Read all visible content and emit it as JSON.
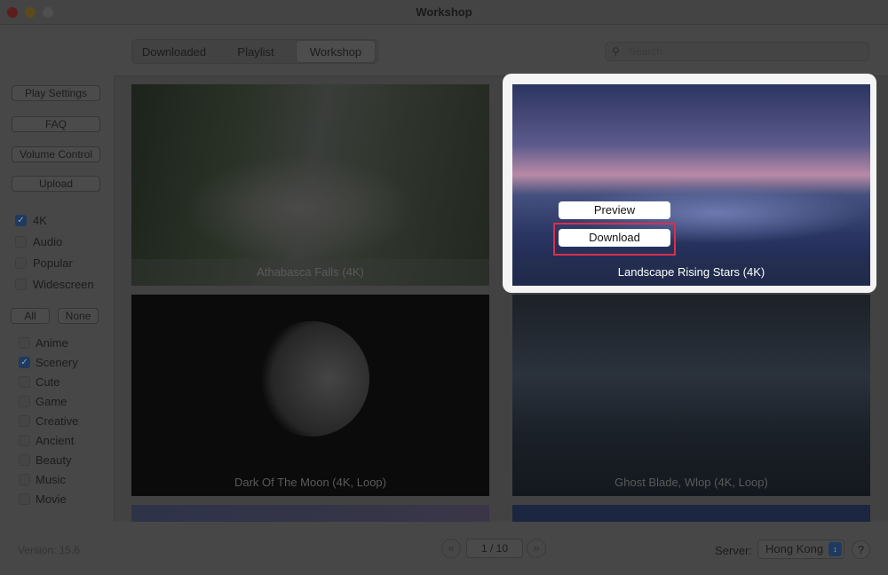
{
  "window": {
    "title": "Workshop"
  },
  "tabs": [
    {
      "label": "Downloaded"
    },
    {
      "label": "Playlist"
    },
    {
      "label": "Workshop",
      "active": true
    }
  ],
  "search": {
    "placeholder": "Search",
    "value": ""
  },
  "sidebar": {
    "buttons": [
      {
        "label": "Play Settings"
      },
      {
        "label": "FAQ"
      },
      {
        "label": "Volume Control"
      },
      {
        "label": "Upload"
      }
    ],
    "filters": [
      {
        "label": "4K",
        "checked": true
      },
      {
        "label": "Audio",
        "checked": false
      },
      {
        "label": "Popular",
        "checked": false
      },
      {
        "label": "Widescreen",
        "checked": false
      }
    ],
    "all_label": "All",
    "none_label": "None",
    "categories": [
      {
        "label": "Anime",
        "checked": false
      },
      {
        "label": "Scenery",
        "checked": true
      },
      {
        "label": "Cute",
        "checked": false
      },
      {
        "label": "Game",
        "checked": false
      },
      {
        "label": "Creative",
        "checked": false
      },
      {
        "label": "Ancient",
        "checked": false
      },
      {
        "label": "Beauty",
        "checked": false
      },
      {
        "label": "Music",
        "checked": false
      },
      {
        "label": "Movie",
        "checked": false
      }
    ]
  },
  "grid": {
    "items": [
      {
        "title": "Athabasca Falls (4K)"
      },
      {
        "title": "Landscape Rising Stars (4K)",
        "highlighted": true
      },
      {
        "title": "Dark Of The Moon (4K, Loop)"
      },
      {
        "title": "Ghost Blade, Wlop (4K, Loop)"
      }
    ],
    "preview_label": "Preview",
    "download_label": "Download"
  },
  "footer": {
    "version": "Version: 15.6",
    "page": "1 / 10",
    "server_label": "Server:",
    "server_value": "Hong Kong",
    "help": "?"
  },
  "colors": {
    "highlight_border": "#d9304a",
    "checkbox_on": "#1f3a5e"
  }
}
